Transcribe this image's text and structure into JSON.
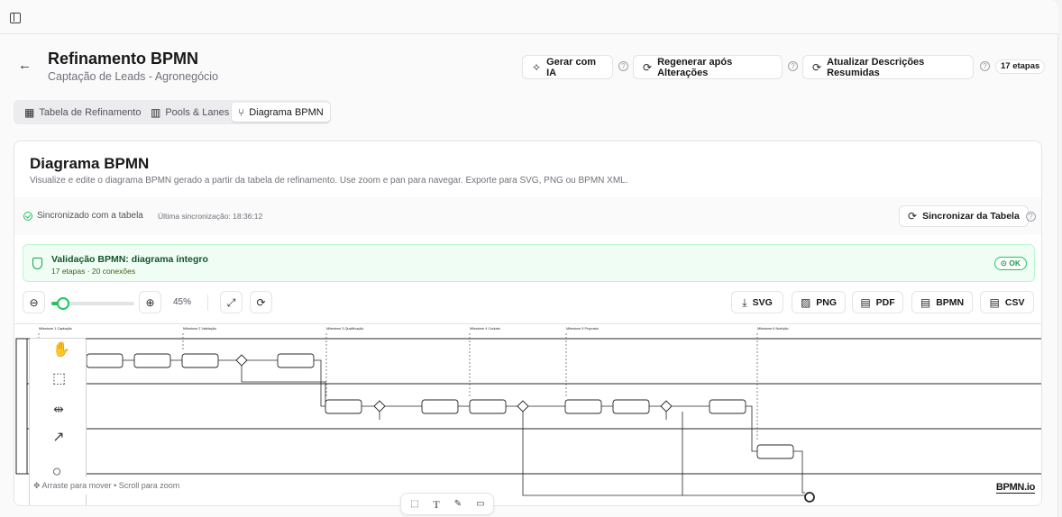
{
  "header": {
    "title": "Refinamento BPMN",
    "subtitle": "Captação de Leads - Agronegócio",
    "actions": {
      "generate": "Gerar com IA",
      "regenerate": "Regenerar após Alterações",
      "update": "Atualizar Descrições Resumidas"
    },
    "steps_badge": "17 etapas"
  },
  "tabs": [
    {
      "label": "Tabela de Refinamento",
      "icon": "table-icon"
    },
    {
      "label": "Pools & Lanes",
      "icon": "building-icon"
    },
    {
      "label": "Diagrama BPMN",
      "icon": "git-branch-icon"
    }
  ],
  "card": {
    "title": "Diagrama BPMN",
    "description": "Visualize e edite o diagrama BPMN gerado a partir da tabela de refinamento. Use zoom e pan para navegar. Exporte para SVG, PNG ou BPMN XML."
  },
  "sync": {
    "status": "Sincronizado com a tabela",
    "last": "Última sincronização: 18:36:12",
    "button": "Sincronizar da Tabela"
  },
  "validation": {
    "title": "Validação BPMN: diagrama íntegro",
    "detail": "17 etapas · 20 conexões",
    "status": "OK"
  },
  "toolbar": {
    "zoom_text": "45%",
    "zoom_percent": 45,
    "exports": [
      "SVG",
      "PNG",
      "PDF",
      "BPMN",
      "CSV"
    ]
  },
  "diagram": {
    "hint": "Arraste para mover • Scroll para zoom",
    "logo": "BPMN.io",
    "milestones": [
      "Milestone 1 Captação",
      "Milestone 2 Validação",
      "Milestone 3 Qualificação",
      "Milestone 4 Contato",
      "Milestone 5 Proposta",
      "Milestone 6 Nutrição"
    ]
  }
}
